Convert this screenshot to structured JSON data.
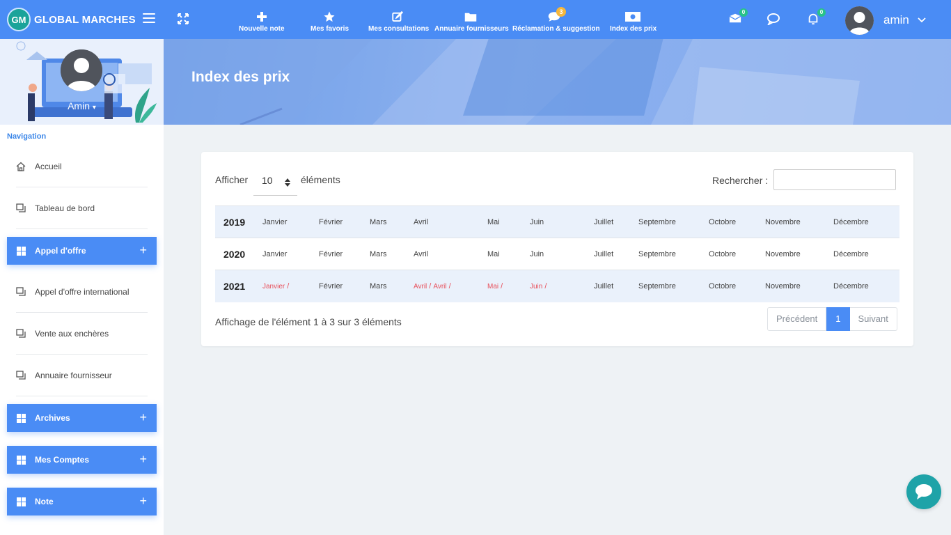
{
  "brand": {
    "logo_text": "GM",
    "name": "GLOBAL MARCHES"
  },
  "topnav": [
    {
      "label": "Nouvelle note",
      "icon": "plus-icon"
    },
    {
      "label": "Mes favoris",
      "icon": "star-icon"
    },
    {
      "label": "Mes consultations",
      "icon": "edit-icon"
    },
    {
      "label": "Annuaire fournisseurs",
      "icon": "folder-icon"
    },
    {
      "label": "Réclamation & suggestion",
      "icon": "comment-icon",
      "badge": "3"
    },
    {
      "label": "Index des prix",
      "icon": "money-icon"
    }
  ],
  "header_icons": {
    "mail_badge": "0",
    "notification_badge": "0"
  },
  "user": {
    "name": "amin"
  },
  "sidebar": {
    "profile_name": "Amin",
    "heading": "Navigation",
    "items": [
      {
        "label": "Accueil"
      },
      {
        "label": "Tableau de bord"
      },
      {
        "label": "Appel d'offre"
      },
      {
        "label": "Appel d'offre international"
      },
      {
        "label": "Vente aux enchères"
      },
      {
        "label": "Annuaire fournisseur"
      },
      {
        "label": "Archives"
      },
      {
        "label": "Mes Comptes"
      },
      {
        "label": "Note"
      }
    ],
    "plus": "+"
  },
  "banner": {
    "title": "Index des prix"
  },
  "table_controls": {
    "show_label": "Afficher",
    "page_length": "10",
    "elements_label": "éléments",
    "search_label": "Rechercher :",
    "search_value": ""
  },
  "table": {
    "rows": [
      {
        "year": "2019",
        "months": [
          "Janvier",
          "Février",
          "Mars",
          "Avril",
          "Mai",
          "Juin",
          "Juillet",
          "Septembre",
          "Octobre",
          "Novembre",
          "Décembre"
        ]
      },
      {
        "year": "2020",
        "months": [
          "Janvier",
          "Février",
          "Mars",
          "Avril",
          "Mai",
          "Juin",
          "Juillet",
          "Septembre",
          "Octobre",
          "Novembre",
          "Décembre"
        ]
      },
      {
        "year": "2021",
        "months": [
          "Janvier",
          "Février",
          "Mars",
          "Avril",
          "Mai",
          "Juin",
          "Juillet",
          "Septembre",
          "Octobre",
          "Novembre",
          "Décembre"
        ],
        "links": {
          "janvier": "Janvier",
          "avril_1": "Avril",
          "avril_2": "Avril",
          "mai": "Mai",
          "juin": "Juin"
        },
        "separator": "/"
      }
    ]
  },
  "footer": {
    "info": "Affichage de l'élément 1 à 3 sur 3 éléments",
    "prev": "Précédent",
    "page": "1",
    "next": "Suivant"
  },
  "colors": {
    "primary": "#4a8cf5",
    "link_red": "#e8505b",
    "chat": "#1fa3a8"
  }
}
